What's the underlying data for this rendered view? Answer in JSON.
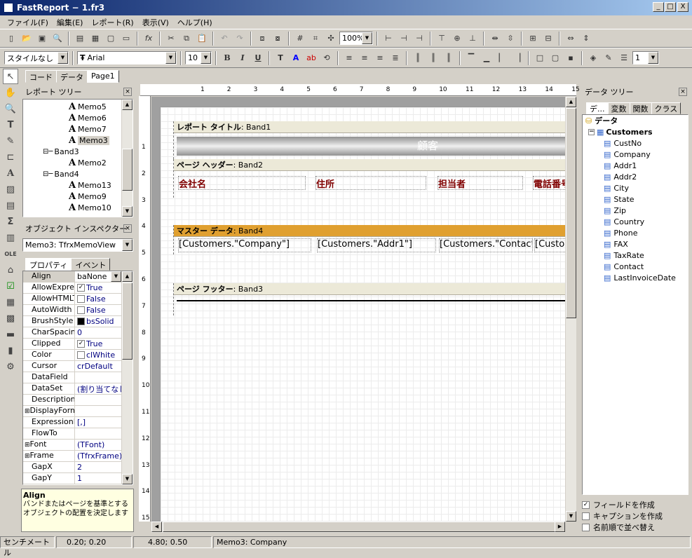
{
  "window": {
    "title": "FastReport − 1.fr3",
    "min": "_",
    "max": "□",
    "close": "X"
  },
  "menu": [
    "ファイル(F)",
    "編集(E)",
    "レポート(R)",
    "表示(V)",
    "ヘルプ(H)"
  ],
  "toolbar": {
    "zoom": "100%",
    "style": "スタイルなし",
    "font": "Arial",
    "font_size": "10",
    "line_width": "1",
    "bold": "B",
    "italic": "I",
    "underline": "U"
  },
  "doc_tabs": [
    "コード",
    "データ",
    "Page1"
  ],
  "report_tree": {
    "title": "レポート ツリー",
    "items": [
      {
        "label": "Memo5",
        "indent": 3
      },
      {
        "label": "Memo6",
        "indent": 3
      },
      {
        "label": "Memo7",
        "indent": 3
      },
      {
        "label": "Memo3",
        "indent": 3,
        "selected": true
      },
      {
        "label": "Band3",
        "indent": 2,
        "band": true
      },
      {
        "label": "Memo2",
        "indent": 3
      },
      {
        "label": "Band4",
        "indent": 2,
        "band": true
      },
      {
        "label": "Memo13",
        "indent": 3
      },
      {
        "label": "Memo9",
        "indent": 3
      },
      {
        "label": "Memo10",
        "indent": 3
      }
    ]
  },
  "inspector": {
    "title": "オブジェクト インスペクター",
    "object": "Memo3: TfrxMemoView",
    "tabs": [
      "プロパティ",
      "イベント"
    ],
    "props": [
      {
        "name": "Align",
        "value": "baNone",
        "combo": true
      },
      {
        "name": "AllowExpress",
        "value": "True",
        "check": true
      },
      {
        "name": "AllowHTMLTa",
        "value": "False",
        "check": false
      },
      {
        "name": "AutoWidth",
        "value": "False",
        "check": false
      },
      {
        "name": "BrushStyle",
        "value": "bsSolid",
        "swatch": "#000000"
      },
      {
        "name": "CharSpacing",
        "value": "0"
      },
      {
        "name": "Clipped",
        "value": "True",
        "check": true
      },
      {
        "name": "Color",
        "value": "clWhite",
        "swatch": "#ffffff"
      },
      {
        "name": "Cursor",
        "value": "crDefault"
      },
      {
        "name": "DataField",
        "value": ""
      },
      {
        "name": "DataSet",
        "value": "(割り当てなし"
      },
      {
        "name": "Description",
        "value": ""
      },
      {
        "name": "DisplayForma",
        "value": "",
        "expand": true
      },
      {
        "name": "ExpressionDe",
        "value": "[,]"
      },
      {
        "name": "FlowTo",
        "value": ""
      },
      {
        "name": "Font",
        "value": "(TFont)",
        "expand": true
      },
      {
        "name": "Frame",
        "value": "(TfrxFrame)",
        "expand": true
      },
      {
        "name": "GapX",
        "value": "2"
      },
      {
        "name": "GapY",
        "value": "1"
      }
    ],
    "help_title": "Align",
    "help_text": "バンドまたはページを基準とするオブジェクトの配置を決定します"
  },
  "ruler": [
    "1",
    "2",
    "3",
    "4",
    "5",
    "6",
    "7",
    "8",
    "9",
    "10",
    "11",
    "12",
    "13",
    "14",
    "15"
  ],
  "vruler": [
    "1",
    "2",
    "3",
    "4",
    "5",
    "6",
    "7",
    "8",
    "9",
    "10",
    "11",
    "12",
    "13",
    "14",
    "15"
  ],
  "bands": {
    "title": {
      "label": "レポート タイトル",
      "name": ": Band1",
      "memo": "顧客"
    },
    "header": {
      "label": "ページ ヘッダー",
      "name": ": Band2",
      "cols": [
        "会社名",
        "住所",
        "担当者",
        "電話番号"
      ]
    },
    "master": {
      "label": "マスター データ",
      "name": ": Band4",
      "cols": [
        "[Customers.\"Company\"]",
        "[Customers.\"Addr1\"]",
        "[Customers.\"Contact\"]",
        "[Customers.\"Phone\"]"
      ]
    },
    "footer": {
      "label": "ページ フッター",
      "name": ": Band3"
    }
  },
  "data_tree": {
    "title": "データ ツリー",
    "tabs": [
      "デ...",
      "変数",
      "関数",
      "クラス"
    ],
    "root": "データ",
    "dataset": "Customers",
    "fields": [
      "CustNo",
      "Company",
      "Addr1",
      "Addr2",
      "City",
      "State",
      "Zip",
      "Country",
      "Phone",
      "FAX",
      "TaxRate",
      "Contact",
      "LastInvoiceDate"
    ],
    "options": [
      {
        "label": "フィールドを作成",
        "checked": true
      },
      {
        "label": "キャプションを作成",
        "checked": false
      },
      {
        "label": "名前順で並べ替え",
        "checked": false
      }
    ]
  },
  "status": {
    "unit": "センチメートル",
    "pos": "0.20; 0.20",
    "size": "4.80; 0.50",
    "object": "Memo3: Company"
  },
  "colors": {
    "master_band": "#e0a030",
    "title_memo": "#808080",
    "header_text": "#800000"
  }
}
